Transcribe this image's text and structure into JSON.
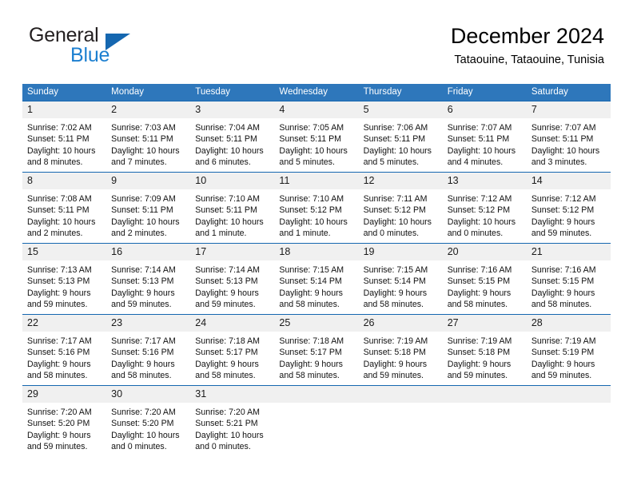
{
  "brand": {
    "name_part1": "General",
    "name_part2": "Blue",
    "logo_icon": "triangle-logo-icon"
  },
  "header": {
    "title": "December 2024",
    "subtitle": "Tataouine, Tataouine, Tunisia"
  },
  "colors": {
    "header_blue": "#2e77bb",
    "row_rule_blue": "#1567b0",
    "daynum_band": "#f0f0f0",
    "brand_blue": "#1c7fd0",
    "logo_blue": "#1567b0"
  },
  "weekday_headers": [
    "Sunday",
    "Monday",
    "Tuesday",
    "Wednesday",
    "Thursday",
    "Friday",
    "Saturday"
  ],
  "weeks": [
    [
      {
        "day": "1",
        "sunrise": "Sunrise: 7:02 AM",
        "sunset": "Sunset: 5:11 PM",
        "daylight_line1": "Daylight: 10 hours",
        "daylight_line2": "and 8 minutes."
      },
      {
        "day": "2",
        "sunrise": "Sunrise: 7:03 AM",
        "sunset": "Sunset: 5:11 PM",
        "daylight_line1": "Daylight: 10 hours",
        "daylight_line2": "and 7 minutes."
      },
      {
        "day": "3",
        "sunrise": "Sunrise: 7:04 AM",
        "sunset": "Sunset: 5:11 PM",
        "daylight_line1": "Daylight: 10 hours",
        "daylight_line2": "and 6 minutes."
      },
      {
        "day": "4",
        "sunrise": "Sunrise: 7:05 AM",
        "sunset": "Sunset: 5:11 PM",
        "daylight_line1": "Daylight: 10 hours",
        "daylight_line2": "and 5 minutes."
      },
      {
        "day": "5",
        "sunrise": "Sunrise: 7:06 AM",
        "sunset": "Sunset: 5:11 PM",
        "daylight_line1": "Daylight: 10 hours",
        "daylight_line2": "and 5 minutes."
      },
      {
        "day": "6",
        "sunrise": "Sunrise: 7:07 AM",
        "sunset": "Sunset: 5:11 PM",
        "daylight_line1": "Daylight: 10 hours",
        "daylight_line2": "and 4 minutes."
      },
      {
        "day": "7",
        "sunrise": "Sunrise: 7:07 AM",
        "sunset": "Sunset: 5:11 PM",
        "daylight_line1": "Daylight: 10 hours",
        "daylight_line2": "and 3 minutes."
      }
    ],
    [
      {
        "day": "8",
        "sunrise": "Sunrise: 7:08 AM",
        "sunset": "Sunset: 5:11 PM",
        "daylight_line1": "Daylight: 10 hours",
        "daylight_line2": "and 2 minutes."
      },
      {
        "day": "9",
        "sunrise": "Sunrise: 7:09 AM",
        "sunset": "Sunset: 5:11 PM",
        "daylight_line1": "Daylight: 10 hours",
        "daylight_line2": "and 2 minutes."
      },
      {
        "day": "10",
        "sunrise": "Sunrise: 7:10 AM",
        "sunset": "Sunset: 5:11 PM",
        "daylight_line1": "Daylight: 10 hours",
        "daylight_line2": "and 1 minute."
      },
      {
        "day": "11",
        "sunrise": "Sunrise: 7:10 AM",
        "sunset": "Sunset: 5:12 PM",
        "daylight_line1": "Daylight: 10 hours",
        "daylight_line2": "and 1 minute."
      },
      {
        "day": "12",
        "sunrise": "Sunrise: 7:11 AM",
        "sunset": "Sunset: 5:12 PM",
        "daylight_line1": "Daylight: 10 hours",
        "daylight_line2": "and 0 minutes."
      },
      {
        "day": "13",
        "sunrise": "Sunrise: 7:12 AM",
        "sunset": "Sunset: 5:12 PM",
        "daylight_line1": "Daylight: 10 hours",
        "daylight_line2": "and 0 minutes."
      },
      {
        "day": "14",
        "sunrise": "Sunrise: 7:12 AM",
        "sunset": "Sunset: 5:12 PM",
        "daylight_line1": "Daylight: 9 hours",
        "daylight_line2": "and 59 minutes."
      }
    ],
    [
      {
        "day": "15",
        "sunrise": "Sunrise: 7:13 AM",
        "sunset": "Sunset: 5:13 PM",
        "daylight_line1": "Daylight: 9 hours",
        "daylight_line2": "and 59 minutes."
      },
      {
        "day": "16",
        "sunrise": "Sunrise: 7:14 AM",
        "sunset": "Sunset: 5:13 PM",
        "daylight_line1": "Daylight: 9 hours",
        "daylight_line2": "and 59 minutes."
      },
      {
        "day": "17",
        "sunrise": "Sunrise: 7:14 AM",
        "sunset": "Sunset: 5:13 PM",
        "daylight_line1": "Daylight: 9 hours",
        "daylight_line2": "and 59 minutes."
      },
      {
        "day": "18",
        "sunrise": "Sunrise: 7:15 AM",
        "sunset": "Sunset: 5:14 PM",
        "daylight_line1": "Daylight: 9 hours",
        "daylight_line2": "and 58 minutes."
      },
      {
        "day": "19",
        "sunrise": "Sunrise: 7:15 AM",
        "sunset": "Sunset: 5:14 PM",
        "daylight_line1": "Daylight: 9 hours",
        "daylight_line2": "and 58 minutes."
      },
      {
        "day": "20",
        "sunrise": "Sunrise: 7:16 AM",
        "sunset": "Sunset: 5:15 PM",
        "daylight_line1": "Daylight: 9 hours",
        "daylight_line2": "and 58 minutes."
      },
      {
        "day": "21",
        "sunrise": "Sunrise: 7:16 AM",
        "sunset": "Sunset: 5:15 PM",
        "daylight_line1": "Daylight: 9 hours",
        "daylight_line2": "and 58 minutes."
      }
    ],
    [
      {
        "day": "22",
        "sunrise": "Sunrise: 7:17 AM",
        "sunset": "Sunset: 5:16 PM",
        "daylight_line1": "Daylight: 9 hours",
        "daylight_line2": "and 58 minutes."
      },
      {
        "day": "23",
        "sunrise": "Sunrise: 7:17 AM",
        "sunset": "Sunset: 5:16 PM",
        "daylight_line1": "Daylight: 9 hours",
        "daylight_line2": "and 58 minutes."
      },
      {
        "day": "24",
        "sunrise": "Sunrise: 7:18 AM",
        "sunset": "Sunset: 5:17 PM",
        "daylight_line1": "Daylight: 9 hours",
        "daylight_line2": "and 58 minutes."
      },
      {
        "day": "25",
        "sunrise": "Sunrise: 7:18 AM",
        "sunset": "Sunset: 5:17 PM",
        "daylight_line1": "Daylight: 9 hours",
        "daylight_line2": "and 58 minutes."
      },
      {
        "day": "26",
        "sunrise": "Sunrise: 7:19 AM",
        "sunset": "Sunset: 5:18 PM",
        "daylight_line1": "Daylight: 9 hours",
        "daylight_line2": "and 59 minutes."
      },
      {
        "day": "27",
        "sunrise": "Sunrise: 7:19 AM",
        "sunset": "Sunset: 5:18 PM",
        "daylight_line1": "Daylight: 9 hours",
        "daylight_line2": "and 59 minutes."
      },
      {
        "day": "28",
        "sunrise": "Sunrise: 7:19 AM",
        "sunset": "Sunset: 5:19 PM",
        "daylight_line1": "Daylight: 9 hours",
        "daylight_line2": "and 59 minutes."
      }
    ],
    [
      {
        "day": "29",
        "sunrise": "Sunrise: 7:20 AM",
        "sunset": "Sunset: 5:20 PM",
        "daylight_line1": "Daylight: 9 hours",
        "daylight_line2": "and 59 minutes."
      },
      {
        "day": "30",
        "sunrise": "Sunrise: 7:20 AM",
        "sunset": "Sunset: 5:20 PM",
        "daylight_line1": "Daylight: 10 hours",
        "daylight_line2": "and 0 minutes."
      },
      {
        "day": "31",
        "sunrise": "Sunrise: 7:20 AM",
        "sunset": "Sunset: 5:21 PM",
        "daylight_line1": "Daylight: 10 hours",
        "daylight_line2": "and 0 minutes."
      },
      {
        "day": "",
        "sunrise": "",
        "sunset": "",
        "daylight_line1": "",
        "daylight_line2": ""
      },
      {
        "day": "",
        "sunrise": "",
        "sunset": "",
        "daylight_line1": "",
        "daylight_line2": ""
      },
      {
        "day": "",
        "sunrise": "",
        "sunset": "",
        "daylight_line1": "",
        "daylight_line2": ""
      },
      {
        "day": "",
        "sunrise": "",
        "sunset": "",
        "daylight_line1": "",
        "daylight_line2": ""
      }
    ]
  ]
}
